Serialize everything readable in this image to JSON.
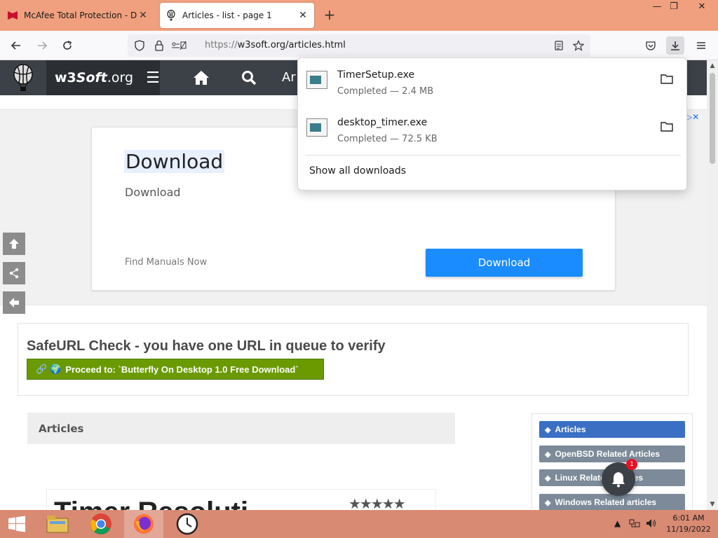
{
  "browser": {
    "tabs": [
      {
        "title": "McAfee Total Protection - Down",
        "active": false
      },
      {
        "title": "Articles - list - page 1",
        "active": true
      }
    ],
    "url_scheme": "https://",
    "url_rest": "w3soft.org/articles.html"
  },
  "site": {
    "brand_prefix": "w3",
    "brand_italic": "Soft",
    "brand_suffix": ".org",
    "nav_partial": "Ar"
  },
  "ad": {
    "title": "Download",
    "subtitle": "Download",
    "link": "Find Manuals Now",
    "button": "Download"
  },
  "safeurl": {
    "title": "SafeURL Check - you have one URL in queue to verify",
    "button": "Proceed to: `Butterfly On Desktop 1.0 Free Download`"
  },
  "articles": {
    "header": "Articles",
    "card_title": "Timer Resoluti"
  },
  "sidebar": {
    "items": [
      {
        "label": "Articles",
        "color": "#3a6fc4"
      },
      {
        "label": "OpenBSD Related Articles",
        "color": "#7c8a99"
      },
      {
        "label": "Linux Related Articles",
        "color": "#7c8a99"
      },
      {
        "label": "Windows Related articles",
        "color": "#7c8a99"
      }
    ]
  },
  "notification": {
    "count": "1"
  },
  "downloads": {
    "items": [
      {
        "name": "TimerSetup.exe",
        "status": "Completed — 2.4 MB"
      },
      {
        "name": "desktop_timer.exe",
        "status": "Completed — 72.5 KB"
      }
    ],
    "show_all": "Show all downloads"
  },
  "taskbar": {
    "time": "6:01 AM",
    "date": "11/19/2022"
  }
}
